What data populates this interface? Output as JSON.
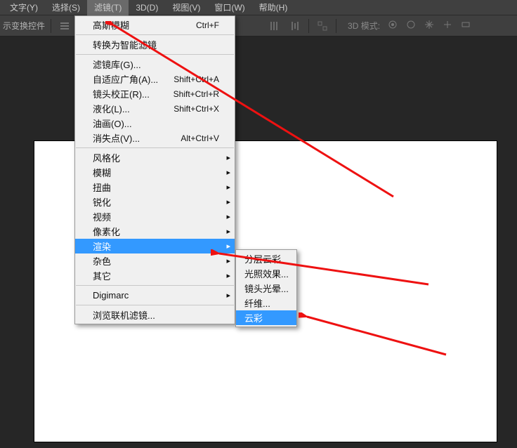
{
  "menubar": {
    "items": [
      {
        "label": "文字(Y)"
      },
      {
        "label": "选择(S)"
      },
      {
        "label": "滤镜(T)"
      },
      {
        "label": "3D(D)"
      },
      {
        "label": "视图(V)"
      },
      {
        "label": "窗口(W)"
      },
      {
        "label": "帮助(H)"
      }
    ]
  },
  "toolbar": {
    "label": "示变换控件",
    "mode3d_label": "3D 模式:"
  },
  "dropdown": {
    "top": {
      "label": "高斯模糊",
      "shortcut": "Ctrl+F"
    },
    "smart": {
      "label": "转换为智能滤镜"
    },
    "group1": [
      {
        "label": "滤镜库(G)...",
        "shortcut": ""
      },
      {
        "label": "自适应广角(A)...",
        "shortcut": "Shift+Ctrl+A"
      },
      {
        "label": "镜头校正(R)...",
        "shortcut": "Shift+Ctrl+R"
      },
      {
        "label": "液化(L)...",
        "shortcut": "Shift+Ctrl+X"
      },
      {
        "label": "油画(O)...",
        "shortcut": ""
      },
      {
        "label": "消失点(V)...",
        "shortcut": "Alt+Ctrl+V"
      }
    ],
    "group2": [
      {
        "label": "风格化"
      },
      {
        "label": "模糊"
      },
      {
        "label": "扭曲"
      },
      {
        "label": "锐化"
      },
      {
        "label": "视频"
      },
      {
        "label": "像素化"
      },
      {
        "label": "渲染"
      },
      {
        "label": "杂色"
      },
      {
        "label": "其它"
      }
    ],
    "digimarc": {
      "label": "Digimarc"
    },
    "browse": {
      "label": "浏览联机滤镜..."
    }
  },
  "submenu": {
    "items": [
      {
        "label": "分层云彩"
      },
      {
        "label": "光照效果..."
      },
      {
        "label": "镜头光晕..."
      },
      {
        "label": "纤维..."
      },
      {
        "label": "云彩"
      }
    ]
  }
}
